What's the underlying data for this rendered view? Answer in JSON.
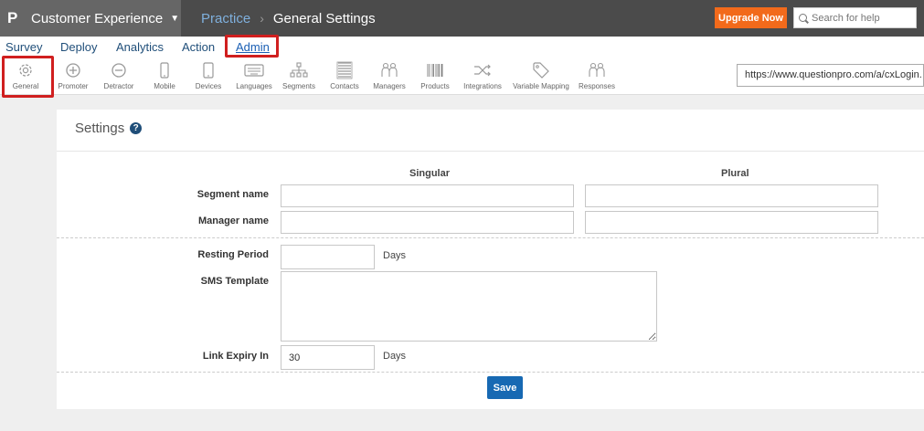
{
  "app": {
    "logo": "P",
    "title": "Customer Experience",
    "breadcrumb": {
      "parent": "Practice",
      "separator": "›",
      "current": "General Settings"
    },
    "upgrade_label": "Upgrade Now",
    "search_placeholder": "Search for help"
  },
  "menu": {
    "items": [
      "Survey",
      "Deploy",
      "Analytics",
      "Action",
      "Admin"
    ],
    "active": "Admin"
  },
  "toolbar": {
    "items": [
      {
        "label": "General",
        "icon": "gear-icon",
        "selected": true
      },
      {
        "label": "Promoter",
        "icon": "plus-circle-icon"
      },
      {
        "label": "Detractor",
        "icon": "minus-circle-icon"
      },
      {
        "label": "Mobile",
        "icon": "mobile-icon"
      },
      {
        "label": "Devices",
        "icon": "device-icon"
      },
      {
        "label": "Languages",
        "icon": "keyboard-icon"
      },
      {
        "label": "Segments",
        "icon": "hierarchy-icon"
      },
      {
        "label": "Contacts",
        "icon": "contacts-list-icon"
      },
      {
        "label": "Managers",
        "icon": "managers-icon"
      },
      {
        "label": "Products",
        "icon": "barcode-icon"
      },
      {
        "label": "Integrations",
        "icon": "shuffle-icon"
      },
      {
        "label": "Variable Mapping",
        "icon": "tag-icon"
      },
      {
        "label": "Responses",
        "icon": "responses-icon"
      }
    ],
    "url": "https://www.questionpro.com/a/cxLogin."
  },
  "settings": {
    "title": "Settings",
    "columns": {
      "singular": "Singular",
      "plural": "Plural"
    },
    "segment_name_label": "Segment name",
    "manager_name_label": "Manager name",
    "resting_period_label": "Resting Period",
    "resting_period_value": "",
    "resting_period_unit": "Days",
    "sms_template_label": "SMS Template",
    "link_expiry_label": "Link Expiry In",
    "link_expiry_value": "30",
    "link_expiry_unit": "Days",
    "save_label": "Save"
  },
  "colors": {
    "topbar": "#4b4b4b",
    "brand": "#666666",
    "upgrade": "#f26a1b",
    "highlight": "#d01f1f",
    "save": "#1769b3"
  }
}
